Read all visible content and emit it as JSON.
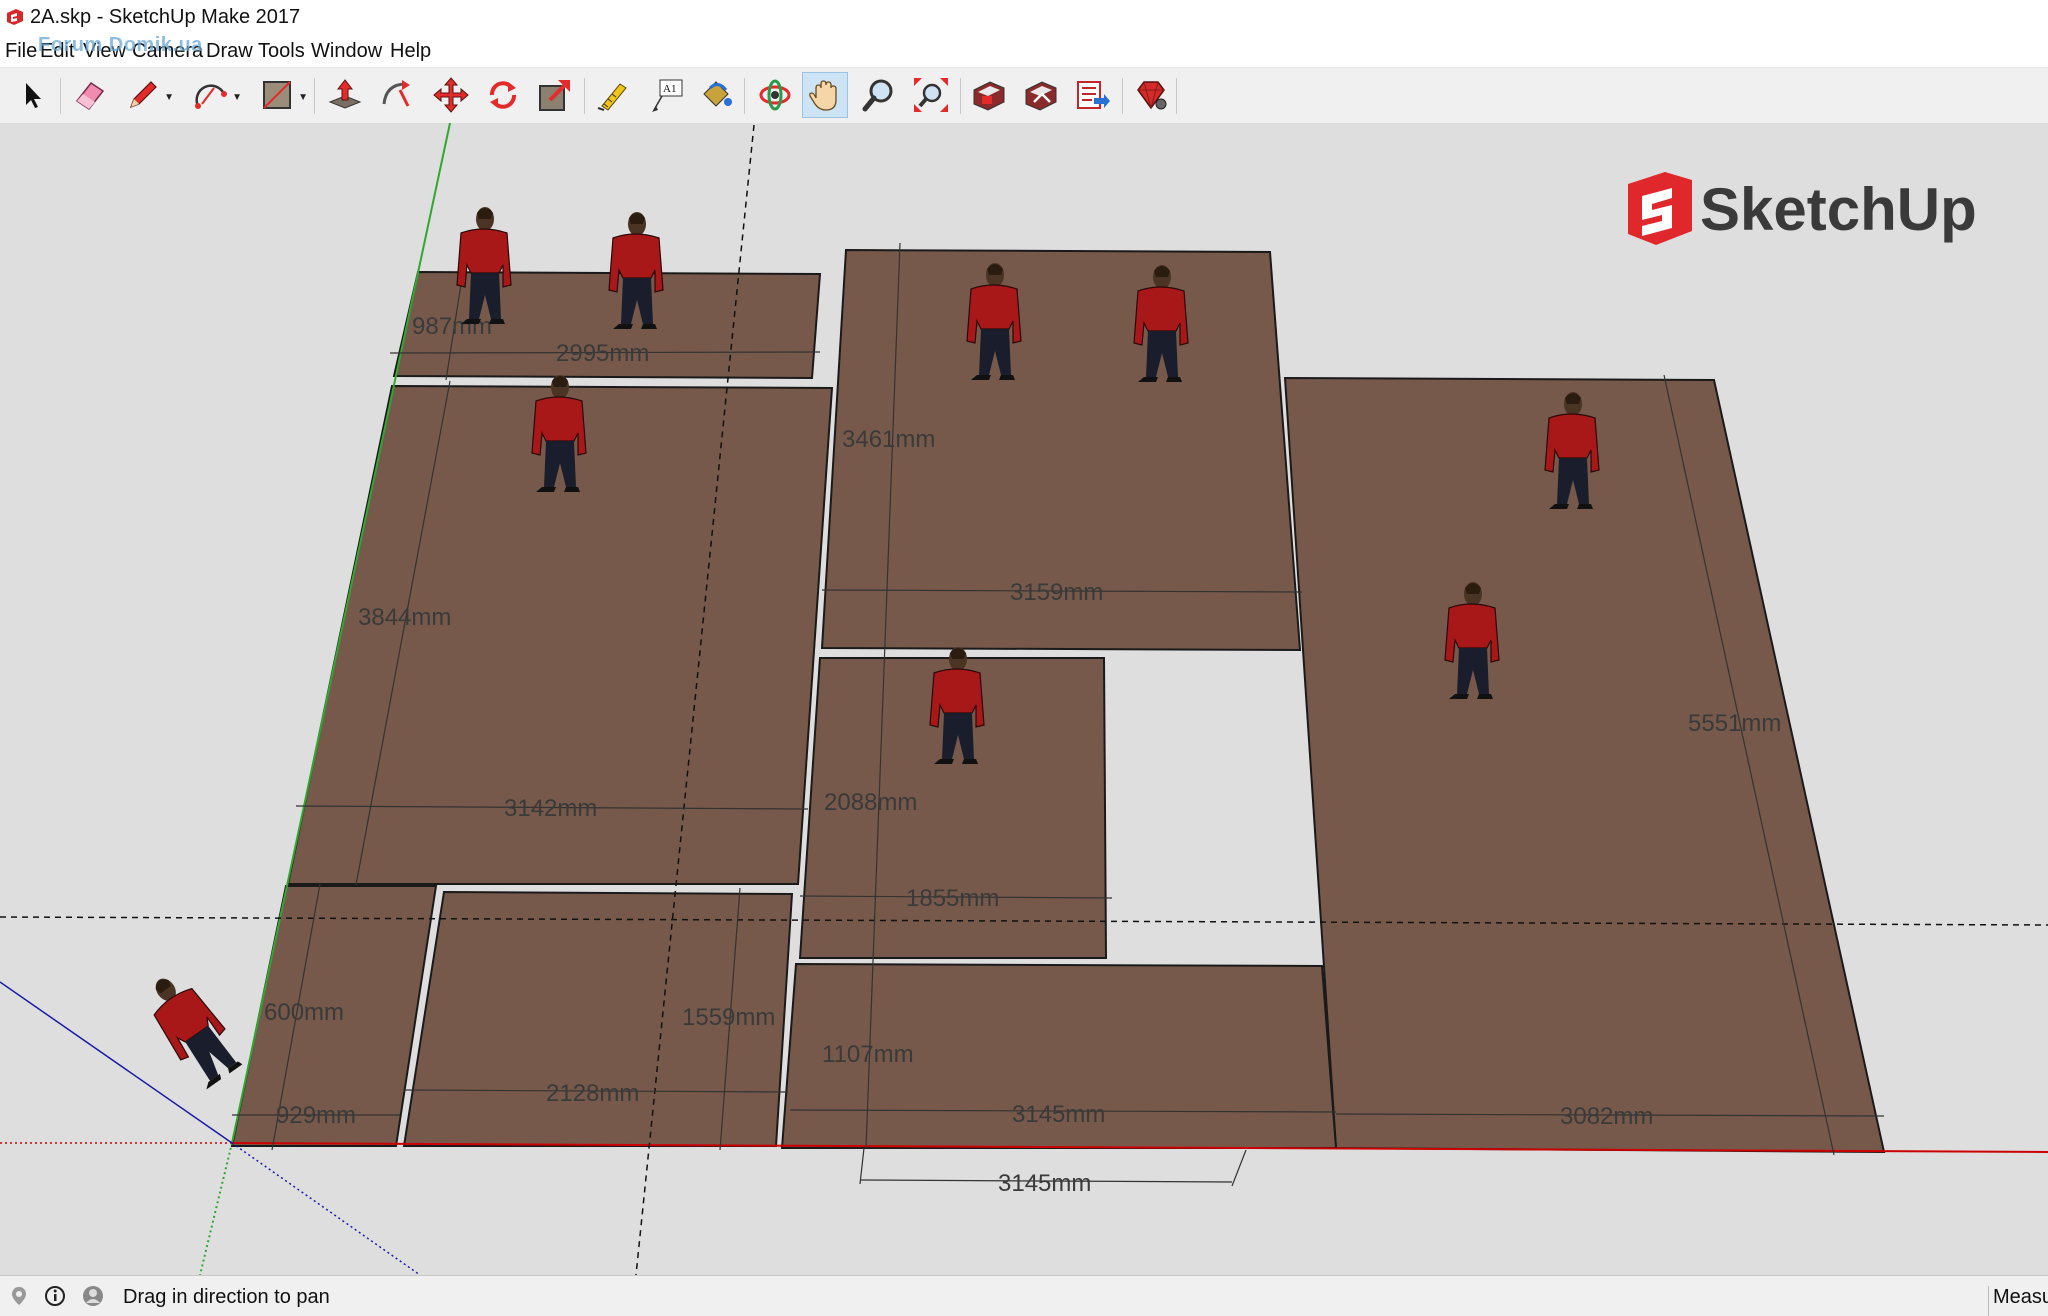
{
  "window": {
    "title": "2A.skp - SketchUp Make 2017"
  },
  "menu": [
    "File",
    "Edit",
    "View",
    "Camera",
    "Draw",
    "Tools",
    "Window",
    "Help"
  ],
  "watermark": "Forum Domik.ua",
  "toolbar": {
    "tools": [
      "select-tool",
      "eraser-tool",
      "pencil-tool",
      "arc-tool",
      "rectangle-tool",
      "push-pull-tool",
      "offset-tool",
      "move-tool",
      "rotate-tool",
      "scale-tool",
      "tape-measure-tool",
      "text-tool",
      "paint-bucket-tool",
      "orbit-tool",
      "pan-tool",
      "zoom-tool",
      "zoom-extents-tool",
      "warehouse-tool",
      "share-model-tool",
      "extension-warehouse-tool",
      "extension-manager-tool"
    ],
    "active": "pan-tool",
    "text_tool_glyph": "A1"
  },
  "viewport": {
    "logo_text": "SketchUp",
    "dimensions": {
      "d987": "987mm",
      "d2995": "2995mm",
      "d3461": "3461mm",
      "d3844": "3844mm",
      "d3159": "3159mm",
      "d3142": "3142mm",
      "d2088": "2088mm",
      "d5551": "5551mm",
      "d1855": "1855mm",
      "d600": "600mm",
      "d1559": "1559mm",
      "d1107": "1107mm",
      "d2128": "2128mm",
      "d929": "929mm",
      "d3145a": "3145mm",
      "d3082": "3082mm",
      "d3145b": "3145mm"
    },
    "colors": {
      "panel": "#76594a",
      "background": "#dedede",
      "red_axis": "#cc0000",
      "green_axis": "#2fa82f",
      "blue_axis": "#1a1aa8"
    }
  },
  "status": {
    "hint": "Drag in direction to pan",
    "measurements_label": "Measu"
  }
}
